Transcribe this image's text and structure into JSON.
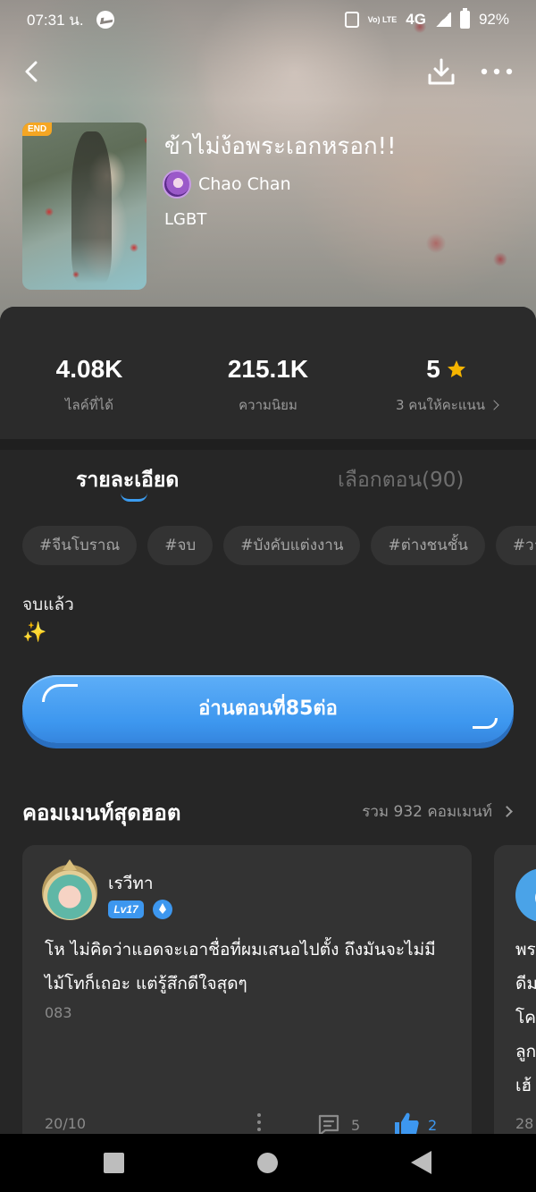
{
  "status_bar": {
    "time": "07:31 น.",
    "network": "4G",
    "volte": "Vo) LTE",
    "battery": "92%",
    "icons": [
      "messenger-icon",
      "vibrate-icon",
      "volte-icon",
      "signal-icon",
      "battery-icon"
    ]
  },
  "nav": {
    "icons": [
      "back-icon",
      "download-icon",
      "more-icon"
    ]
  },
  "book": {
    "badge": "END",
    "title": "ข้าไม่ง้อพระเอกหรอก!!",
    "author": "Chao Chan",
    "genre": "LGBT"
  },
  "stats": {
    "likes_value": "4.08K",
    "likes_label": "ไลค์ที่ได้",
    "popularity_value": "215.1K",
    "popularity_label": "ความนิยม",
    "rating_value": "5",
    "rating_label": "3 คนให้คะแนน"
  },
  "tabs": [
    {
      "label": "รายละเอียด",
      "active": true
    },
    {
      "label": "เลือกตอน(90)",
      "active": false
    }
  ],
  "tags": [
    "#จีนโบราณ",
    "#จบ",
    "#บังคับแต่งงาน",
    "#ต่างชนชั้น",
    "#วา"
  ],
  "description": {
    "line1": "จบแล้ว",
    "line2": "✨"
  },
  "read_button": {
    "label": "อ่านตอนที่85ต่อ"
  },
  "hot_comments": {
    "title": "คอมเมนท์สุดฮอต",
    "total": "รวม 932 คอมเมนท์",
    "comments": [
      {
        "user": "เรวีทา",
        "level": "Lv17",
        "text": "โห ไม่คิดว่าแอดจะเอาชื่อที่ผมเสนอไปตั้ง ถึงมันจะไม่มีไม้โทก็เถอะ แต่รู้สึกดีใจสุดๆ",
        "chapter": "083",
        "date": "20/10",
        "replies": "5",
        "likes": "2"
      },
      {
        "text_lines": [
          "พร",
          "ดีม",
          "โค",
          "ลูก",
          "เฮ้"
        ],
        "date": "28"
      }
    ]
  },
  "colors": {
    "accent": "#3d97ef",
    "background": "#262626",
    "card": "#333333",
    "star": "#f5b400",
    "end_badge": "#f5a623"
  }
}
